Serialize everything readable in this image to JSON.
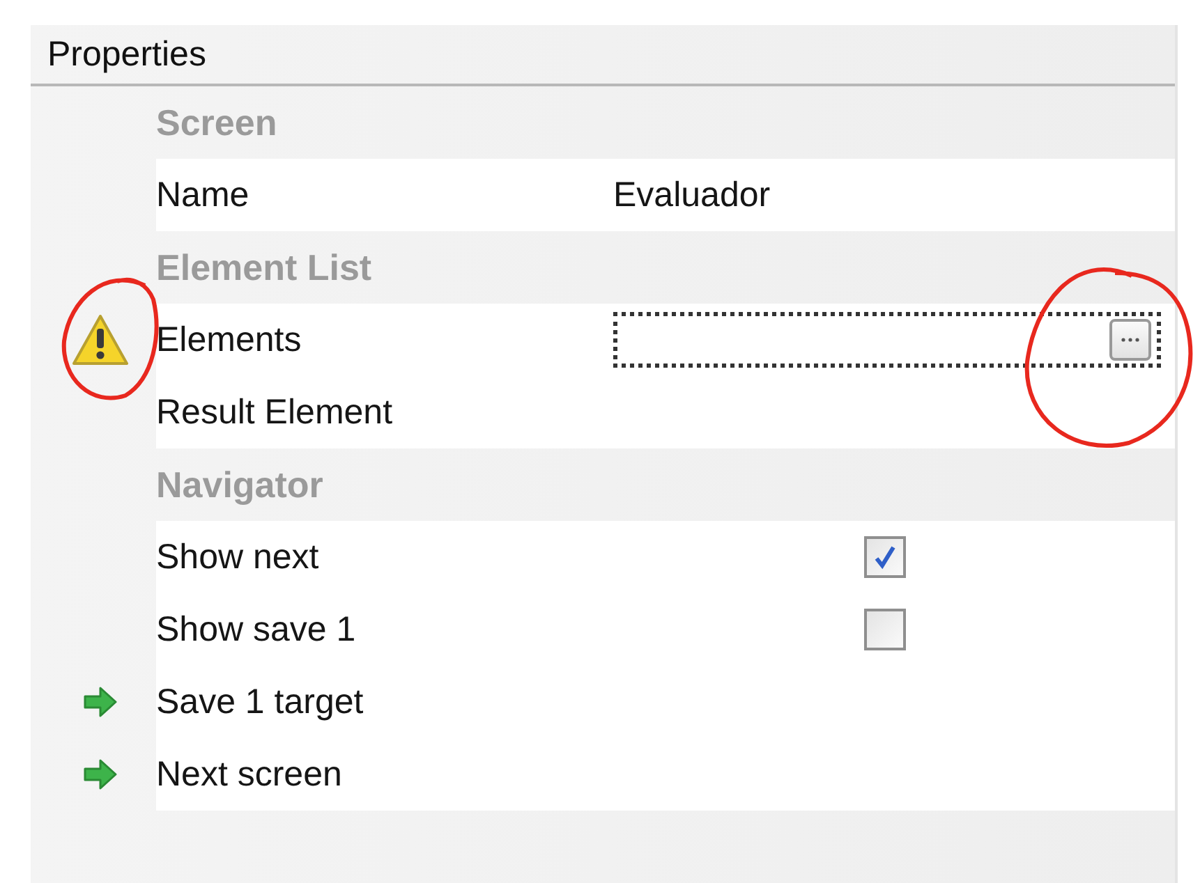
{
  "panel": {
    "title": "Properties"
  },
  "rows": [
    {
      "kind": "category",
      "label": "Screen"
    },
    {
      "kind": "text",
      "label": "Name",
      "value": "Evaluador"
    },
    {
      "kind": "category",
      "label": "Element List"
    },
    {
      "kind": "collection",
      "label": "Elements",
      "warning": true,
      "focused": true
    },
    {
      "kind": "text",
      "label": "Result Element"
    },
    {
      "kind": "category",
      "label": "Navigator"
    },
    {
      "kind": "checkbox",
      "label": "Show next",
      "checked": true
    },
    {
      "kind": "checkbox",
      "label": "Show save 1",
      "checked": false
    },
    {
      "kind": "link",
      "label": "Save 1 target"
    },
    {
      "kind": "link",
      "label": "Next screen"
    }
  ]
}
